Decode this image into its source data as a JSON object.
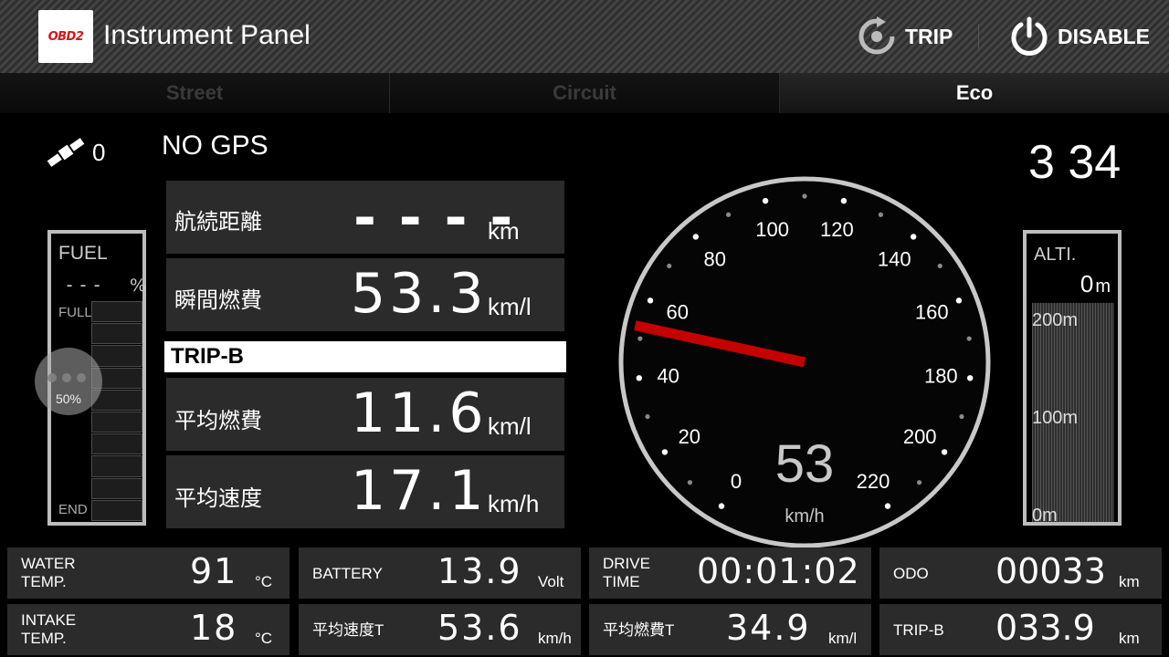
{
  "header": {
    "logo_text": "OBD2",
    "title": "Instrument Panel",
    "trip_label": "TRIP",
    "disable_label": "DISABLE",
    "trip_icon": "reset-icon",
    "disable_icon": "power-icon"
  },
  "tabs": [
    {
      "label": "Street",
      "active": false
    },
    {
      "label": "Circuit",
      "active": false
    },
    {
      "label": "Eco",
      "active": true
    }
  ],
  "gps": {
    "icon": "satellite-icon",
    "satellites": "0",
    "status": "NO GPS"
  },
  "clock": "3 34",
  "fuel": {
    "title": "FUEL",
    "value": "---",
    "unit": "%",
    "full_label": "FULL",
    "end_label": "END",
    "handle_label": "50%",
    "handle_level": 0.5
  },
  "panels": {
    "range": {
      "label": "航続距離",
      "value": "- - - -",
      "unit": "km"
    },
    "instant_economy": {
      "label": "瞬間燃費",
      "value": "53.3",
      "unit": "km/l"
    },
    "trip_section": "TRIP-B",
    "avg_economy": {
      "label": "平均燃費",
      "value": "11.6",
      "unit": "km/l"
    },
    "avg_speed": {
      "label": "平均速度",
      "value": "17.1",
      "unit": "km/h"
    }
  },
  "speedometer": {
    "value": "53",
    "unit": "km/h",
    "min": 0,
    "max": 220,
    "needle_value": 53,
    "tick_labels": [
      "0",
      "20",
      "40",
      "60",
      "80",
      "100",
      "120",
      "140",
      "160",
      "180",
      "200",
      "220"
    ],
    "needle_color": "#c40000"
  },
  "altitude": {
    "title": "ALTI.",
    "value": "0",
    "unit": "m",
    "labels": [
      "200m",
      "100m",
      "0m"
    ]
  },
  "tiles": {
    "water_temp": {
      "label": "WATER\nTEMP.",
      "label1": "WATER",
      "label2": "TEMP.",
      "value": "91",
      "unit": "°C"
    },
    "battery": {
      "label": "BATTERY",
      "value": "13.9",
      "unit": "Volt"
    },
    "drive_time": {
      "label1": "DRIVE",
      "label2": "TIME",
      "value": "00:01:02"
    },
    "odo": {
      "label": "ODO",
      "value": "00033",
      "unit": "km"
    },
    "intake_temp": {
      "label1": "INTAKE",
      "label2": "TEMP.",
      "value": "18",
      "unit": "°C"
    },
    "avg_speed_t": {
      "label": "平均速度T",
      "value": "53.6",
      "unit": "km/h"
    },
    "avg_economy_t": {
      "label": "平均燃費T",
      "value": "34.9",
      "unit": "km/l"
    },
    "trip_b": {
      "label": "TRIP-B",
      "value": "033.9",
      "unit": "km"
    }
  }
}
